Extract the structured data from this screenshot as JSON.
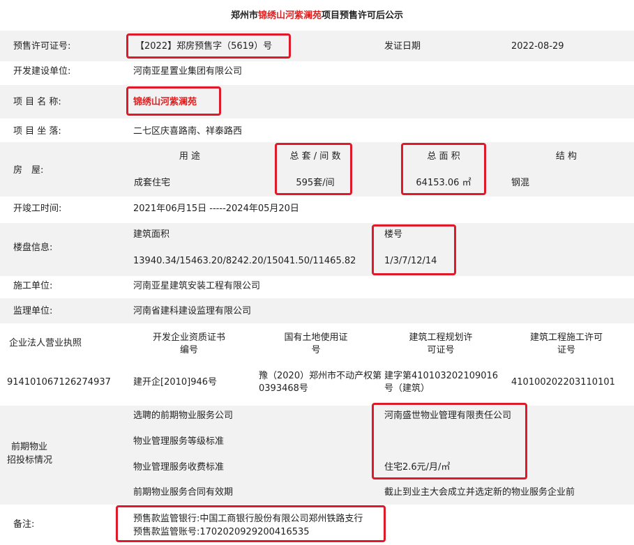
{
  "title": {
    "prefix": "郑州市",
    "highlight": "锦绣山河紫澜苑",
    "suffix": "项目预售许可后公示"
  },
  "permit_no": {
    "label": "预售许可证号:",
    "value": "【2022】郑房预售字（5619）号"
  },
  "issue_date": {
    "label": "发证日期",
    "value": "2022-08-29"
  },
  "developer": {
    "label": "开发建设单位:",
    "value": "河南亚星置业集团有限公司"
  },
  "project_name": {
    "label": "项 目 名 称:",
    "value": "锦绣山河紫澜苑"
  },
  "location": {
    "label": "项 目 坐 落:",
    "value": "二七区庆喜路南、祥泰路西"
  },
  "housing": {
    "label": "房　屋:",
    "headers": {
      "use": "用 途",
      "units": "总 套 / 间 数",
      "area": "总 面 积",
      "structure": "结 构"
    },
    "values": {
      "use": "成套住宅",
      "units": "595套/间",
      "area": "64153.06 ㎡",
      "structure": "钢混"
    }
  },
  "construction_time": {
    "label": "开竣工时间:",
    "value": "2021年06月15日 -----2024年05月20日"
  },
  "building_info": {
    "label": "楼盘信息:",
    "area_label": "建筑面积",
    "area_value": "13940.34/15463.20/8242.20/15041.50/11465.82",
    "bldg_label": "楼号",
    "bldg_value": "1/3/7/12/14"
  },
  "contractor": {
    "label": "施工单位:",
    "value": "河南亚星建筑安装工程有限公司"
  },
  "supervisor": {
    "label": "监理单位:",
    "value": "河南省建科建设监理有限公司"
  },
  "licenses": {
    "h1": "企业法人营业执照",
    "h2": "开发企业资质证书编号",
    "h3": "国有土地使用证号",
    "h4": "建筑工程规划许可证号",
    "h5": "建筑工程施工许可证号",
    "v1": "914101067126274937",
    "v2": "建开企[2010]946号",
    "v3": "豫（2020）郑州市不动产权第0393468号",
    "v4": "建字第410103202109016号（建筑）",
    "v5": "410100202203110101"
  },
  "property_mgmt": {
    "label_line1": "前期物业",
    "label_line2": "招投标情况",
    "company_label": "选聘的前期物业服务公司",
    "company_value": "河南盛世物业管理有限责任公司",
    "grade_label": "物业管理服务等级标准",
    "fee_label": "物业管理服务收费标准",
    "fee_value": "住宅2.6元/月/㎡",
    "validity_label": "前期物业服务合同有效期",
    "validity_value": "截止到业主大会成立并选定新的物业服务企业前"
  },
  "remarks": {
    "label": "备注:",
    "bank": "预售款监管银行:中国工商银行股份有限公司郑州铁路支行",
    "account": "预售款监管账号:1702020929200416535"
  },
  "colors": {
    "highlight_red": "#e02020",
    "box_red": "#e0192a",
    "band_gray": "#f2f2f2"
  }
}
